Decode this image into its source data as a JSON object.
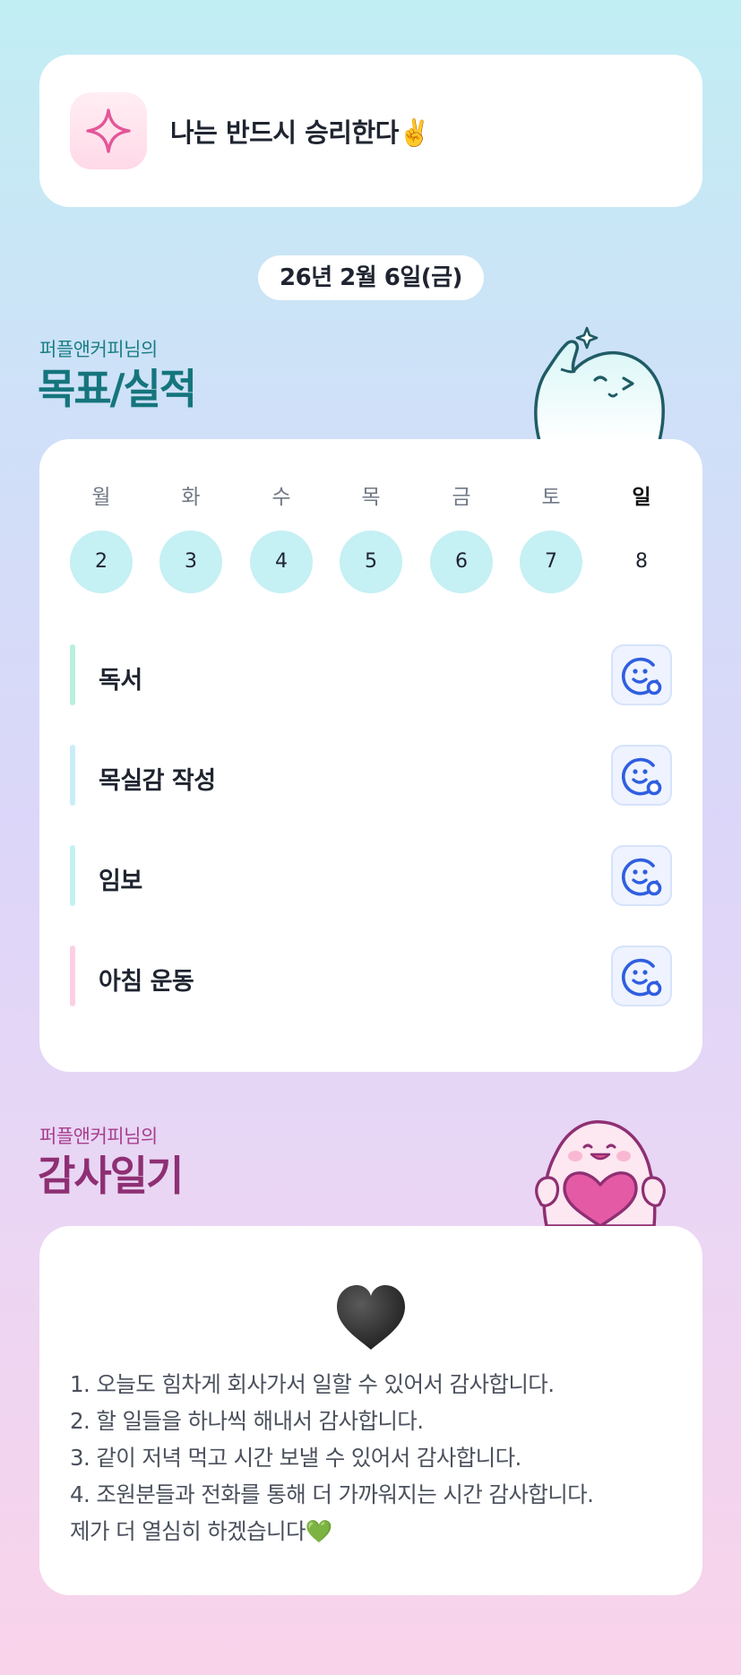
{
  "motto": {
    "text": "나는 반드시 승리한다",
    "emoji": "✌️"
  },
  "date": "26년 2월 6일(금)",
  "goals": {
    "subtitle": "퍼플앤커피님의",
    "title": "목표/실적",
    "days": [
      {
        "label": "월",
        "num": "2",
        "done": true
      },
      {
        "label": "화",
        "num": "3",
        "done": true
      },
      {
        "label": "수",
        "num": "4",
        "done": true
      },
      {
        "label": "목",
        "num": "5",
        "done": true
      },
      {
        "label": "금",
        "num": "6",
        "done": true
      },
      {
        "label": "토",
        "num": "7",
        "done": true
      },
      {
        "label": "일",
        "num": "8",
        "done": false
      }
    ],
    "tasks": [
      {
        "name": "독서",
        "color": "#b9f0dc"
      },
      {
        "name": "목실감 작성",
        "color": "#c9eef7"
      },
      {
        "name": "임보",
        "color": "#c3f1f2"
      },
      {
        "name": "아침 운동",
        "color": "#fcd0e3"
      }
    ]
  },
  "thanks": {
    "subtitle": "퍼플앤커피님의",
    "title": "감사일기",
    "heart_emoji": "🖤",
    "lines": [
      "1. 오늘도 힘차게 회사가서 일할 수 있어서 감사합니다.",
      "2. 할 일들을 하나씩 해내서 감사합니다.",
      "3. 같이 저녁 먹고 시간 보낼 수 있어서 감사합니다.",
      "4. 조원분들과 전화를 통해 더 가까워지는 시간 감사합니다.",
      "제가 더 열심히 하겠습니다"
    ],
    "closing_emoji": "💚"
  },
  "colors": {
    "accent_teal": "#15757c",
    "accent_magenta": "#8e2f73",
    "day_done": "#c5f0f4",
    "emoji_button": "#2f5ee0"
  },
  "icons": {
    "motto": "sparkle-icon",
    "task_button": "smiley-add-icon"
  }
}
